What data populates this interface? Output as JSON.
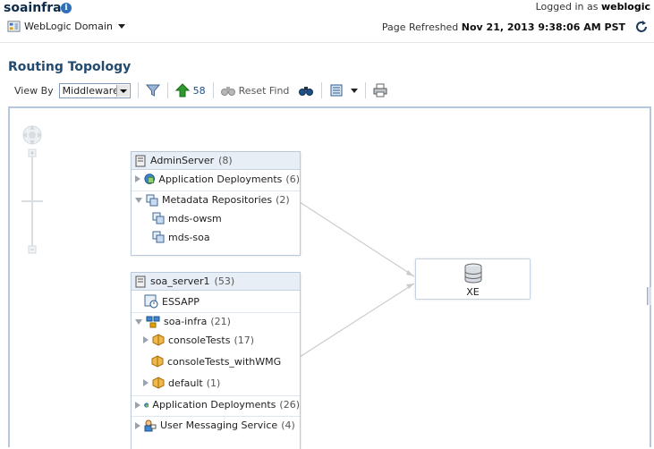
{
  "header": {
    "app_title": "soainfra",
    "logged_in_prefix": "Logged in as",
    "logged_in_user": "weblogic",
    "domain_menu_label": "WebLogic Domain",
    "refresh_prefix": "Page Refreshed",
    "refresh_time": "Nov 21, 2013 9:38:06 AM PST"
  },
  "page": {
    "title": "Routing Topology"
  },
  "toolbar": {
    "view_by_label": "View By",
    "view_by_value": "Middleware",
    "up_count": "58",
    "reset_find_label": "Reset Find"
  },
  "topology": {
    "admin_server": {
      "name": "AdminServer",
      "count": "(8)",
      "app_deployments": {
        "label": "Application Deployments",
        "count": "(6)"
      },
      "metadata_repos": {
        "label": "Metadata Repositories",
        "count": "(2)"
      },
      "repos": [
        "mds-owsm",
        "mds-soa"
      ]
    },
    "soa_server": {
      "name": "soa_server1",
      "count": "(53)",
      "essapp": "ESSAPP",
      "soa_infra": {
        "label": "soa-infra",
        "count": "(21)"
      },
      "console_tests": {
        "label": "consoleTests",
        "count": "(17)"
      },
      "console_tests_wmg": "consoleTests_withWMG",
      "default": {
        "label": "default",
        "count": "(1)"
      },
      "app_deployments": {
        "label": "Application Deployments",
        "count": "(26)"
      },
      "ums": {
        "label": "User Messaging Service",
        "count": "(4)"
      }
    },
    "database": {
      "name": "XE"
    }
  },
  "colors": {
    "title": "#0c2a49",
    "page_title": "#234a6f",
    "canvas_border": "#b6c7dd",
    "node_header": "#e8eef6",
    "up_arrow": "#2e9a2e",
    "connector": "#c8c8c8"
  }
}
